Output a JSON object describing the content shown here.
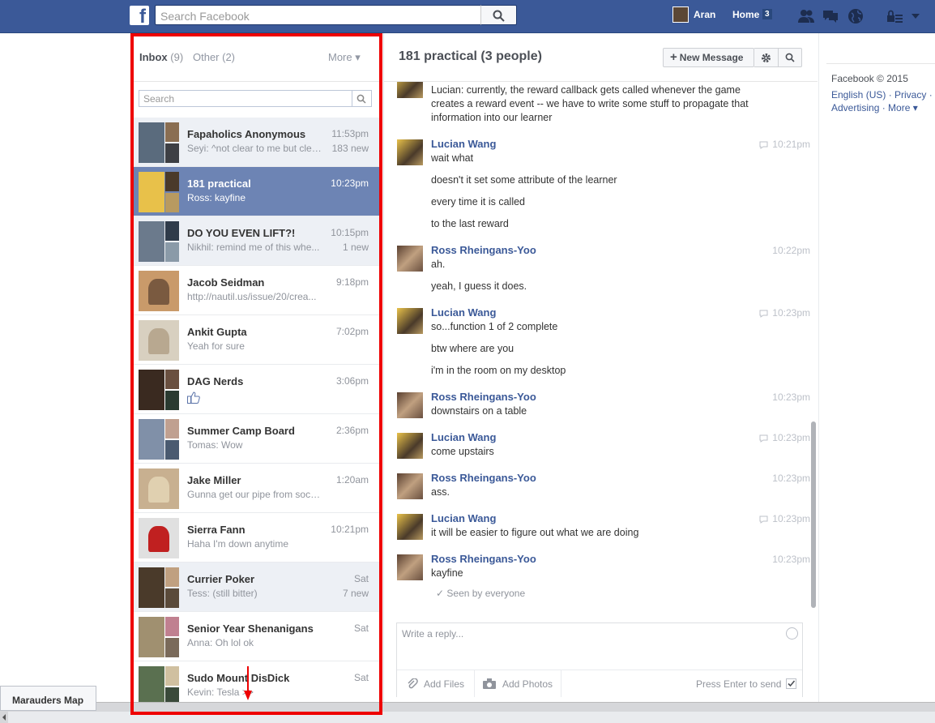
{
  "topbar": {
    "logo": "f",
    "search_placeholder": "Search Facebook",
    "user_name": "Aran",
    "home_label": "Home",
    "home_count": "3"
  },
  "inbox": {
    "inbox_label": "Inbox",
    "inbox_count": "(9)",
    "other_label": "Other (2)",
    "more_label": "More ▾",
    "search_placeholder": "Search",
    "threads": [
      {
        "name": "Fapaholics Anonymous",
        "time": "11:53pm",
        "snippet": "Seyi: ^not clear to me but clea...",
        "new": "183 new"
      },
      {
        "name": "181 practical",
        "time": "10:23pm",
        "snippet": "Ross: kayfine",
        "new": ""
      },
      {
        "name": "DO YOU EVEN LIFT?!",
        "time": "10:15pm",
        "snippet": "Nikhil: remind me of this whe...",
        "new": "1 new"
      },
      {
        "name": "Jacob Seidman",
        "time": "9:18pm",
        "snippet": "http://nautil.us/issue/20/crea...",
        "new": ""
      },
      {
        "name": "Ankit Gupta",
        "time": "7:02pm",
        "snippet": "Yeah for sure",
        "new": ""
      },
      {
        "name": "DAG Nerds",
        "time": "3:06pm",
        "snippet": "",
        "new": ""
      },
      {
        "name": "Summer Camp Board",
        "time": "2:36pm",
        "snippet": "Tomas: Wow",
        "new": ""
      },
      {
        "name": "Jake Miller",
        "time": "1:20am",
        "snippet": "Gunna get our pipe from soch ...",
        "new": ""
      },
      {
        "name": "Sierra Fann",
        "time": "10:21pm",
        "snippet": "Haha I'm down anytime",
        "new": ""
      },
      {
        "name": "Currier Poker",
        "time": "Sat",
        "snippet": "Tess: (still bitter)",
        "new": "7 new"
      },
      {
        "name": "Senior Year Shenanigans",
        "time": "Sat",
        "snippet": "Anna: Oh lol ok",
        "new": ""
      },
      {
        "name": "Sudo Mount DisDick",
        "time": "Sat",
        "snippet": "Kevin: Tesla >>",
        "new": ""
      }
    ]
  },
  "conversation": {
    "title": "181 practical",
    "people": "(3 people)",
    "new_message_label": "New Message",
    "messages": [
      {
        "sender": "",
        "time": "",
        "lines": [
          "Lucian: currently, the reward callback gets called whenever the game",
          "creates a reward event -- we have to write some stuff to propagate that",
          "information into our learner"
        ]
      },
      {
        "sender": "Lucian Wang",
        "time": "10:21pm",
        "lines": [
          "wait what",
          "doesn't it set some attribute of the learner",
          "every time it is called",
          "to the last reward"
        ]
      },
      {
        "sender": "Ross Rheingans-Yoo",
        "time": "10:22pm",
        "lines": [
          "ah.",
          "yeah, I guess it does."
        ]
      },
      {
        "sender": "Lucian Wang",
        "time": "10:23pm",
        "lines": [
          "so...function 1 of 2 complete",
          "btw where are you",
          "i'm in the room on my desktop"
        ]
      },
      {
        "sender": "Ross Rheingans-Yoo",
        "time": "10:23pm",
        "lines": [
          "downstairs on a table"
        ]
      },
      {
        "sender": "Lucian Wang",
        "time": "10:23pm",
        "lines": [
          "come upstairs"
        ]
      },
      {
        "sender": "Ross Rheingans-Yoo",
        "time": "10:23pm",
        "lines": [
          "ass."
        ]
      },
      {
        "sender": "Lucian Wang",
        "time": "10:23pm",
        "lines": [
          "it will be easier to figure out what we are doing"
        ]
      },
      {
        "sender": "Ross Rheingans-Yoo",
        "time": "10:23pm",
        "lines": [
          "kayfine"
        ]
      }
    ],
    "seen": "Seen by everyone",
    "reply_placeholder": "Write a reply...",
    "add_files": "Add Files",
    "add_photos": "Add Photos",
    "press_enter": "Press Enter to send"
  },
  "right_column": {
    "copyright": "Facebook © 2015",
    "links_line1": "English (US) · Privacy ·",
    "links_line2": "Advertising · More ▾"
  },
  "chat_tab": "Marauders Map",
  "colors": {
    "brand": "#3b5998",
    "selected_thread": "#6d84b4",
    "unread_thread": "#edf0f5",
    "annotation_red": "#e00000"
  }
}
